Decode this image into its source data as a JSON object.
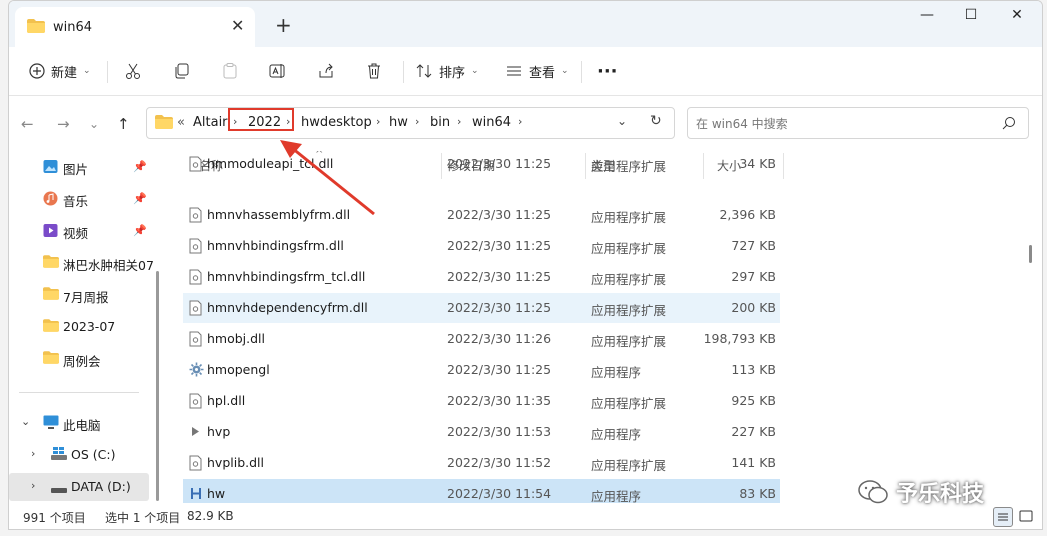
{
  "window": {
    "tab_title": "win64",
    "tab_icon": "folder-icon",
    "colors": {
      "accent": "#0067c0",
      "highlight": "#e03a2b",
      "folder": "#f2c14e"
    }
  },
  "toolbar": {
    "new_label": "新建",
    "sort_label": "排序",
    "view_label": "查看",
    "more_label": "···"
  },
  "address": {
    "overflow": "«",
    "crumbs": [
      "Altair",
      "2022",
      "hwdesktop",
      "hw",
      "bin",
      "win64"
    ],
    "search_placeholder": "在 win64 中搜索"
  },
  "sidebar": {
    "items": [
      {
        "label": "图片",
        "icon": "pictures-icon",
        "pinned": true
      },
      {
        "label": "音乐",
        "icon": "music-icon",
        "pinned": true
      },
      {
        "label": "视频",
        "icon": "videos-icon",
        "pinned": true
      },
      {
        "label": "淋巴水肿相关07",
        "icon": "folder-icon"
      },
      {
        "label": "7月周报",
        "icon": "folder-icon"
      },
      {
        "label": "2023-07",
        "icon": "folder-icon"
      },
      {
        "label": "周例会",
        "icon": "folder-icon"
      }
    ],
    "this_pc": "此电脑",
    "drives": [
      "OS (C:)",
      "DATA (D:)"
    ]
  },
  "columns": {
    "name": "名称",
    "date": "修改日期",
    "type": "类型",
    "size": "大小"
  },
  "files": [
    {
      "name": "hmmoduleapi_tcl.dll",
      "date": "2022/3/30 11:25",
      "type": "应用程序扩展",
      "size": "34 KB",
      "icon": "dll-icon"
    },
    {
      "name": "hmnvhassemblyfrm.dll",
      "date": "2022/3/30 11:25",
      "type": "应用程序扩展",
      "size": "2,396 KB",
      "icon": "dll-icon"
    },
    {
      "name": "hmnvhbindingsfrm.dll",
      "date": "2022/3/30 11:25",
      "type": "应用程序扩展",
      "size": "727 KB",
      "icon": "dll-icon"
    },
    {
      "name": "hmnvhbindingsfrm_tcl.dll",
      "date": "2022/3/30 11:25",
      "type": "应用程序扩展",
      "size": "297 KB",
      "icon": "dll-icon"
    },
    {
      "name": "hmnvhdependencyfrm.dll",
      "date": "2022/3/30 11:25",
      "type": "应用程序扩展",
      "size": "200 KB",
      "icon": "dll-icon"
    },
    {
      "name": "hmobj.dll",
      "date": "2022/3/30 11:26",
      "type": "应用程序扩展",
      "size": "198,793 KB",
      "icon": "dll-icon"
    },
    {
      "name": "hmopengl",
      "date": "2022/3/30 11:25",
      "type": "应用程序",
      "size": "113 KB",
      "icon": "gear-exe-icon"
    },
    {
      "name": "hpl.dll",
      "date": "2022/3/30 11:35",
      "type": "应用程序扩展",
      "size": "925 KB",
      "icon": "dll-icon"
    },
    {
      "name": "hvp",
      "date": "2022/3/30 11:53",
      "type": "应用程序",
      "size": "227 KB",
      "icon": "play-exe-icon"
    },
    {
      "name": "hvplib.dll",
      "date": "2022/3/30 11:52",
      "type": "应用程序扩展",
      "size": "141 KB",
      "icon": "dll-icon"
    },
    {
      "name": "hw",
      "date": "2022/3/30 11:54",
      "type": "应用程序",
      "size": "83 KB",
      "icon": "hw-exe-icon"
    }
  ],
  "status": {
    "count": "991 个项目",
    "selection": "选中 1 个项目",
    "size": "82.9 KB"
  },
  "watermark": "予乐科技"
}
